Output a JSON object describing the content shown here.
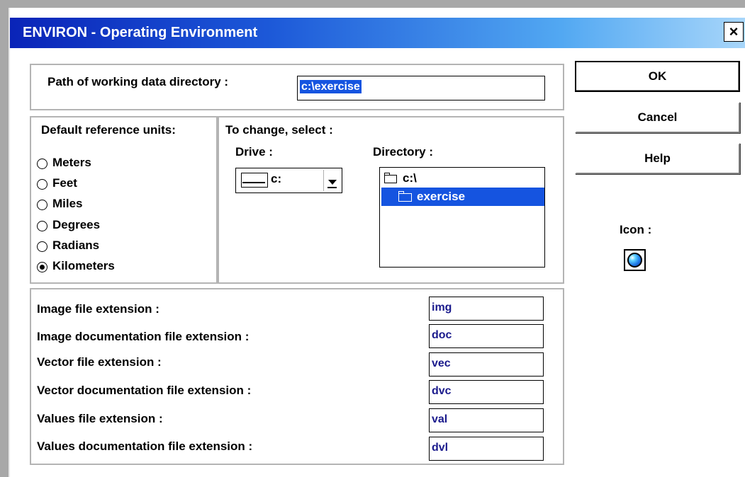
{
  "window": {
    "title": "ENVIRON - Operating Environment",
    "close_glyph": "×"
  },
  "path": {
    "label": "Path of working data directory :",
    "value": "c:\\exercise"
  },
  "units": {
    "label": "Default reference units:",
    "options": [
      {
        "label": "Meters",
        "selected": false
      },
      {
        "label": "Feet",
        "selected": false
      },
      {
        "label": "Miles",
        "selected": false
      },
      {
        "label": "Degrees",
        "selected": false
      },
      {
        "label": "Radians",
        "selected": false
      },
      {
        "label": "Kilometers",
        "selected": true
      }
    ]
  },
  "change": {
    "label": "To change, select :",
    "drive_label": "Drive :",
    "drive_value": "c:",
    "directory_label": "Directory :",
    "directories": [
      {
        "label": "c:\\",
        "icon": "open-folder-icon",
        "selected": false
      },
      {
        "label": "exercise",
        "icon": "open-folder-icon",
        "selected": true
      }
    ]
  },
  "buttons": {
    "ok": "OK",
    "cancel": "Cancel",
    "help": "Help"
  },
  "icon_panel": {
    "label": "Icon :",
    "icon": "globe-icon"
  },
  "extensions": [
    {
      "label": "Image file extension :",
      "value": "img"
    },
    {
      "label": "Image documentation file extension :",
      "value": "doc"
    },
    {
      "label": "Vector file extension :",
      "value": "vec"
    },
    {
      "label": "Vector documentation file extension :",
      "value": "dvc"
    },
    {
      "label": "Values file extension :",
      "value": "val"
    },
    {
      "label": "Values documentation file extension :",
      "value": "dvl"
    }
  ],
  "colors": {
    "title_gradient_start": "#0a24b8",
    "title_gradient_end": "#a8d6fa",
    "selection": "#1554e0",
    "field_text": "#1a1a8c"
  }
}
